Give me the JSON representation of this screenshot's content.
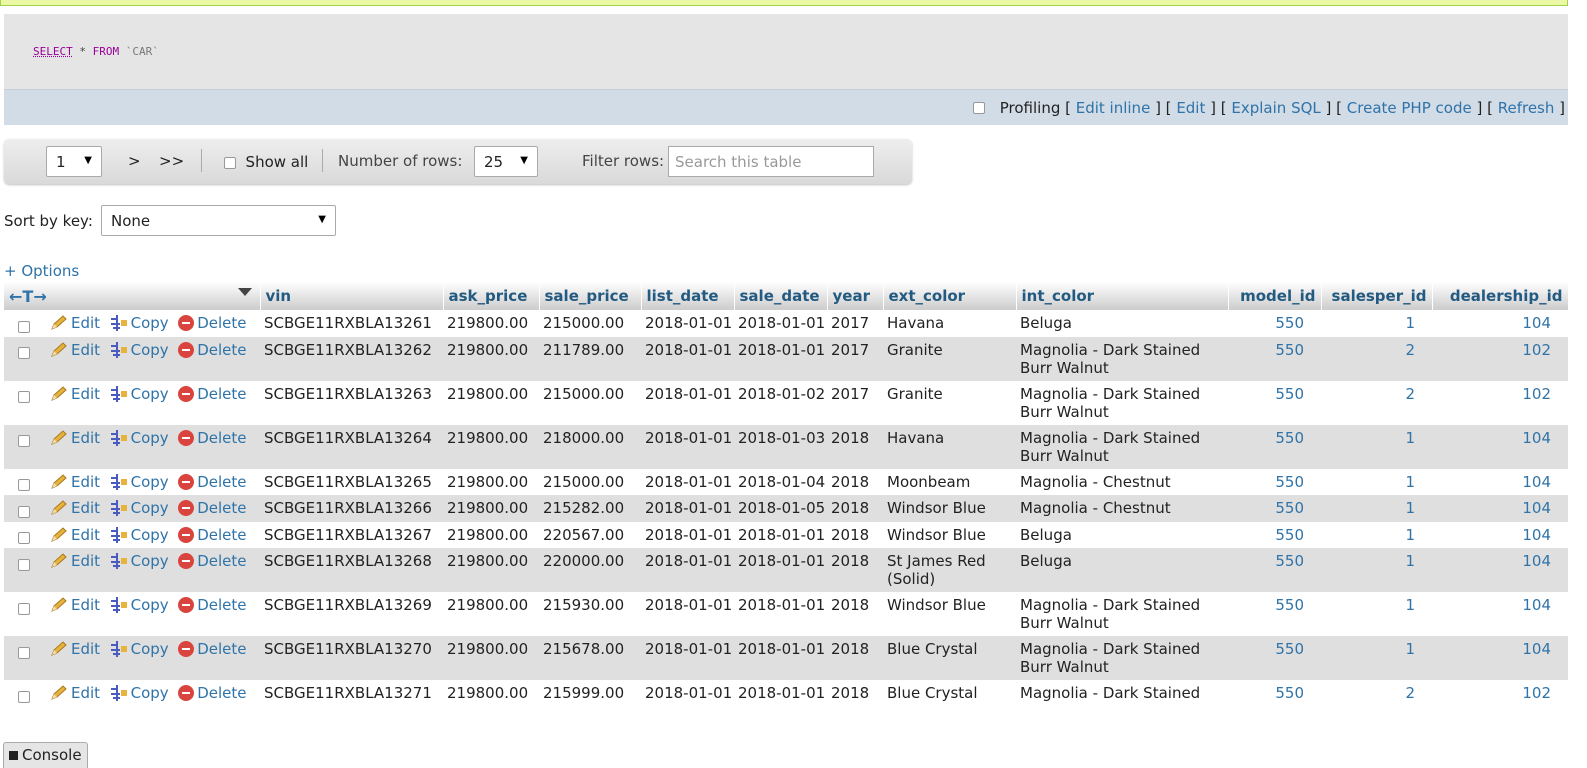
{
  "sql": {
    "keyword_select": "SELECT",
    "star": "*",
    "keyword_from": "FROM",
    "table": "`CAR`"
  },
  "links": {
    "profiling": "Profiling",
    "edit_inline": "Edit inline",
    "edit": "Edit",
    "explain_sql": "Explain SQL",
    "create_php": "Create PHP code",
    "refresh": "Refresh"
  },
  "nav": {
    "page_value": "1",
    "next": ">",
    "last": ">>",
    "show_all": "Show all",
    "rows_label": "Number of rows:",
    "rows_value": "25",
    "filter_label": "Filter rows:",
    "filter_placeholder": "Search this table"
  },
  "sort": {
    "label": "Sort by key:",
    "value": "None"
  },
  "options_label": "+ Options",
  "actions": {
    "edit": "Edit",
    "copy": "Copy",
    "delete": "Delete"
  },
  "columns": [
    "vin",
    "ask_price",
    "sale_price",
    "list_date",
    "sale_date",
    "year",
    "ext_color",
    "int_color",
    "model_id",
    "salesper_id",
    "dealership_id"
  ],
  "rows": [
    [
      "SCBGE11RXBLA13261",
      "219800.00",
      "215000.00",
      "2018-01-01",
      "2018-01-01",
      "2017",
      "Havana",
      "Beluga",
      "550",
      "1",
      "104"
    ],
    [
      "SCBGE11RXBLA13262",
      "219800.00",
      "211789.00",
      "2018-01-01",
      "2018-01-01",
      "2017",
      "Granite",
      "Magnolia - Dark Stained Burr Walnut",
      "550",
      "2",
      "102"
    ],
    [
      "SCBGE11RXBLA13263",
      "219800.00",
      "215000.00",
      "2018-01-01",
      "2018-01-02",
      "2017",
      "Granite",
      "Magnolia - Dark Stained Burr Walnut",
      "550",
      "2",
      "102"
    ],
    [
      "SCBGE11RXBLA13264",
      "219800.00",
      "218000.00",
      "2018-01-01",
      "2018-01-03",
      "2018",
      "Havana",
      "Magnolia - Dark Stained Burr Walnut",
      "550",
      "1",
      "104"
    ],
    [
      "SCBGE11RXBLA13265",
      "219800.00",
      "215000.00",
      "2018-01-01",
      "2018-01-04",
      "2018",
      "Moonbeam",
      "Magnolia - Chestnut",
      "550",
      "1",
      "104"
    ],
    [
      "SCBGE11RXBLA13266",
      "219800.00",
      "215282.00",
      "2018-01-01",
      "2018-01-05",
      "2018",
      "Windsor Blue",
      "Magnolia - Chestnut",
      "550",
      "1",
      "104"
    ],
    [
      "SCBGE11RXBLA13267",
      "219800.00",
      "220567.00",
      "2018-01-01",
      "2018-01-01",
      "2018",
      "Windsor Blue",
      "Beluga",
      "550",
      "1",
      "104"
    ],
    [
      "SCBGE11RXBLA13268",
      "219800.00",
      "220000.00",
      "2018-01-01",
      "2018-01-01",
      "2018",
      "St James Red (Solid)",
      "Beluga",
      "550",
      "1",
      "104"
    ],
    [
      "SCBGE11RXBLA13269",
      "219800.00",
      "215930.00",
      "2018-01-01",
      "2018-01-01",
      "2018",
      "Windsor Blue",
      "Magnolia - Dark Stained Burr Walnut",
      "550",
      "1",
      "104"
    ],
    [
      "SCBGE11RXBLA13270",
      "219800.00",
      "215678.00",
      "2018-01-01",
      "2018-01-01",
      "2018",
      "Blue Crystal",
      "Magnolia - Dark Stained Burr Walnut",
      "550",
      "1",
      "104"
    ],
    [
      "SCBGE11RXBLA13271",
      "219800.00",
      "215999.00",
      "2018-01-01",
      "2018-01-01",
      "2018",
      "Blue Crystal",
      "Magnolia - Dark Stained",
      "550",
      "2",
      "102"
    ]
  ],
  "console_label": "Console"
}
